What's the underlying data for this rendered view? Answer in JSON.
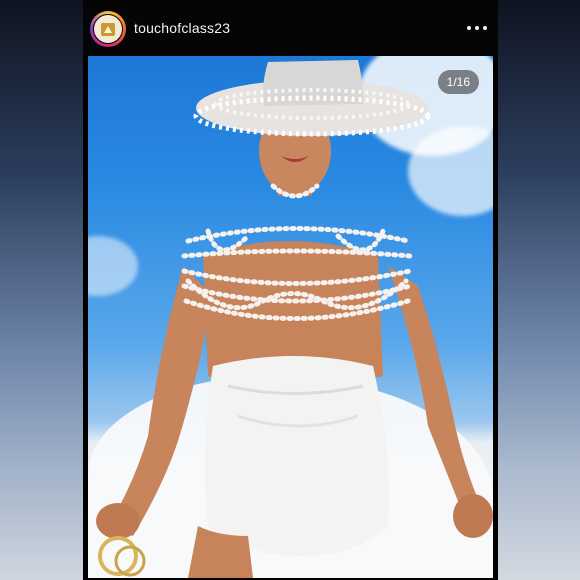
{
  "post": {
    "username": "touchofclass23",
    "counter": "1/16"
  },
  "icons": {
    "more": "more-horizontal-icon",
    "avatar": "profile-avatar"
  }
}
